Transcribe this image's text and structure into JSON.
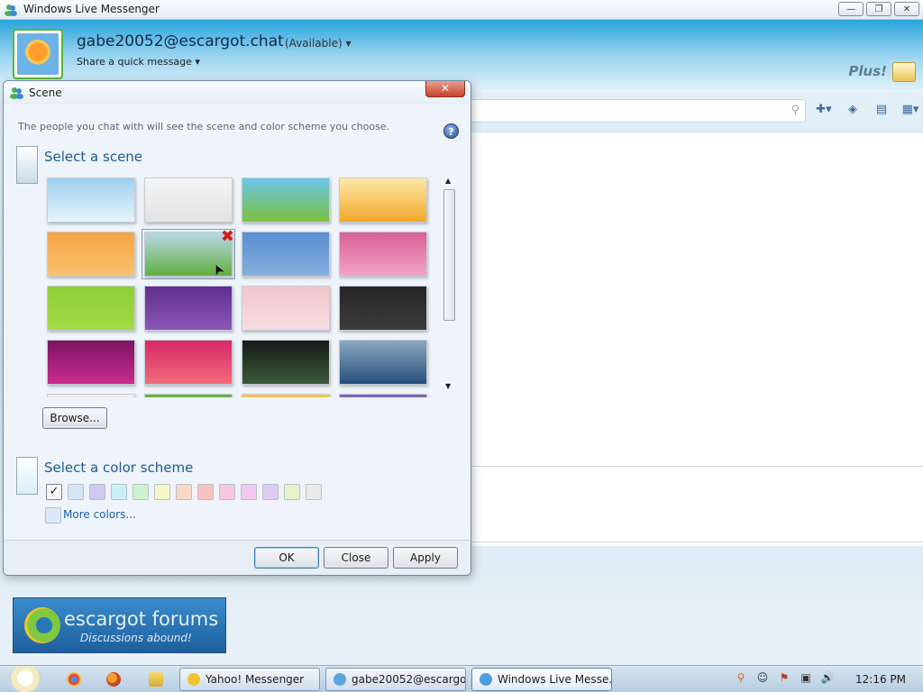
{
  "window": {
    "title": "Windows Live Messenger",
    "minimize_glyph": "—",
    "maximize_glyph": "❐",
    "close_glyph": "✕"
  },
  "profile": {
    "username": "gabe20052@escargot.chat",
    "status": "(Available) ▾",
    "quick_message": "Share a quick message ▾"
  },
  "brand": {
    "plus_logo": "Plus!"
  },
  "toolbar": {
    "search_icon": "⚲",
    "add_contact_icon": "✚▾",
    "sharing_icon": "◈",
    "layout_icon": "▤",
    "options_icon": "▦▾"
  },
  "dialog": {
    "title": "Scene",
    "close_glyph": "✕",
    "description": "The people you chat with will see the scene and color scheme you choose.",
    "help_glyph": "?",
    "scene_section_title": "Select a scene",
    "browse_label": "Browse...",
    "color_section_title": "Select a color scheme",
    "more_colors_label": "More colors...",
    "ok_label": "OK",
    "close_label": "Close",
    "apply_label": "Apply",
    "selected_scene_index": 5,
    "delete_glyph": "✖",
    "cursor_glyph": "➤",
    "scroll_up": "▲",
    "scroll_down": "▼",
    "check_glyph": "✓",
    "scenes": [
      {
        "name": "sky",
        "colors": [
          "#9cd0ee",
          "#e7f4fb"
        ]
      },
      {
        "name": "white-petals",
        "colors": [
          "#f5f5f5",
          "#e2e2e2"
        ]
      },
      {
        "name": "green-hill",
        "colors": [
          "#6cc4ea",
          "#7bc23e"
        ]
      },
      {
        "name": "orange-tree",
        "colors": [
          "#fde8a6",
          "#f3a72a"
        ]
      },
      {
        "name": "orange-grass",
        "colors": [
          "#f6a443",
          "#f8c270"
        ]
      },
      {
        "name": "field-selected",
        "colors": [
          "#b9d9e9",
          "#5fae3e"
        ]
      },
      {
        "name": "blue-mountains",
        "colors": [
          "#5a8fd0",
          "#86aede"
        ]
      },
      {
        "name": "pink-dots",
        "colors": [
          "#d95f98",
          "#f1a3c6"
        ]
      },
      {
        "name": "lime-pattern",
        "colors": [
          "#8ccf37",
          "#a5da48"
        ]
      },
      {
        "name": "purple-swirl",
        "colors": [
          "#5c2f8f",
          "#8c56b8"
        ]
      },
      {
        "name": "pink-blossom",
        "colors": [
          "#f2c7cc",
          "#f7dde1"
        ]
      },
      {
        "name": "dark-lines",
        "colors": [
          "#262626",
          "#3b3b3b"
        ]
      },
      {
        "name": "magenta-flower",
        "colors": [
          "#7d1464",
          "#c92c8f"
        ]
      },
      {
        "name": "pink-dots-wave",
        "colors": [
          "#d72869",
          "#f26b7a"
        ]
      },
      {
        "name": "dark-green-wave",
        "colors": [
          "#151a17",
          "#3b5a3a"
        ]
      },
      {
        "name": "blue-sea-plane",
        "colors": [
          "#8ba6c0",
          "#25507a"
        ]
      },
      {
        "name": "partial-white",
        "colors": [
          "#f0f0f0",
          "#f39a3a"
        ]
      },
      {
        "name": "partial-green",
        "colors": [
          "#63b33a",
          "#9ad05c"
        ]
      },
      {
        "name": "partial-multi",
        "colors": [
          "#f2c94c",
          "#e24a8d"
        ]
      },
      {
        "name": "partial-purple",
        "colors": [
          "#7a5fb5",
          "#cdb8ea"
        ]
      }
    ],
    "color_schemes": [
      {
        "name": "current",
        "color": "#ffffff"
      },
      {
        "name": "light-blue",
        "color": "#d7e3f6"
      },
      {
        "name": "lavender",
        "color": "#cfc8f2"
      },
      {
        "name": "aqua",
        "color": "#c9f0f3"
      },
      {
        "name": "mint",
        "color": "#cdf2d0"
      },
      {
        "name": "yellow",
        "color": "#f6f5c8"
      },
      {
        "name": "peach",
        "color": "#f8d8c3"
      },
      {
        "name": "salmon",
        "color": "#f6c3c1"
      },
      {
        "name": "pink",
        "color": "#f7c8dd"
      },
      {
        "name": "magenta",
        "color": "#f3c7ef"
      },
      {
        "name": "violet",
        "color": "#dccbf3"
      },
      {
        "name": "lime",
        "color": "#e6f5c7"
      },
      {
        "name": "gray",
        "color": "#eaeaea"
      }
    ]
  },
  "ad": {
    "title": "escargot forums",
    "subtitle": "Discussions abound!"
  },
  "taskbar": {
    "tasks": [
      {
        "label": "Yahoo! Messenger",
        "color": "#f2c230"
      },
      {
        "label": "gabe20052@escargo...",
        "color": "#5aa6dc"
      },
      {
        "label": "Windows Live Messe...",
        "color": "#4a9fdc"
      }
    ],
    "tray": {
      "search_glyph": "⚲",
      "face_glyph": "☺",
      "flag_glyph": "⚑",
      "network_glyph": "▣",
      "volume_glyph": "🔊"
    },
    "clock": "12:16 PM"
  }
}
